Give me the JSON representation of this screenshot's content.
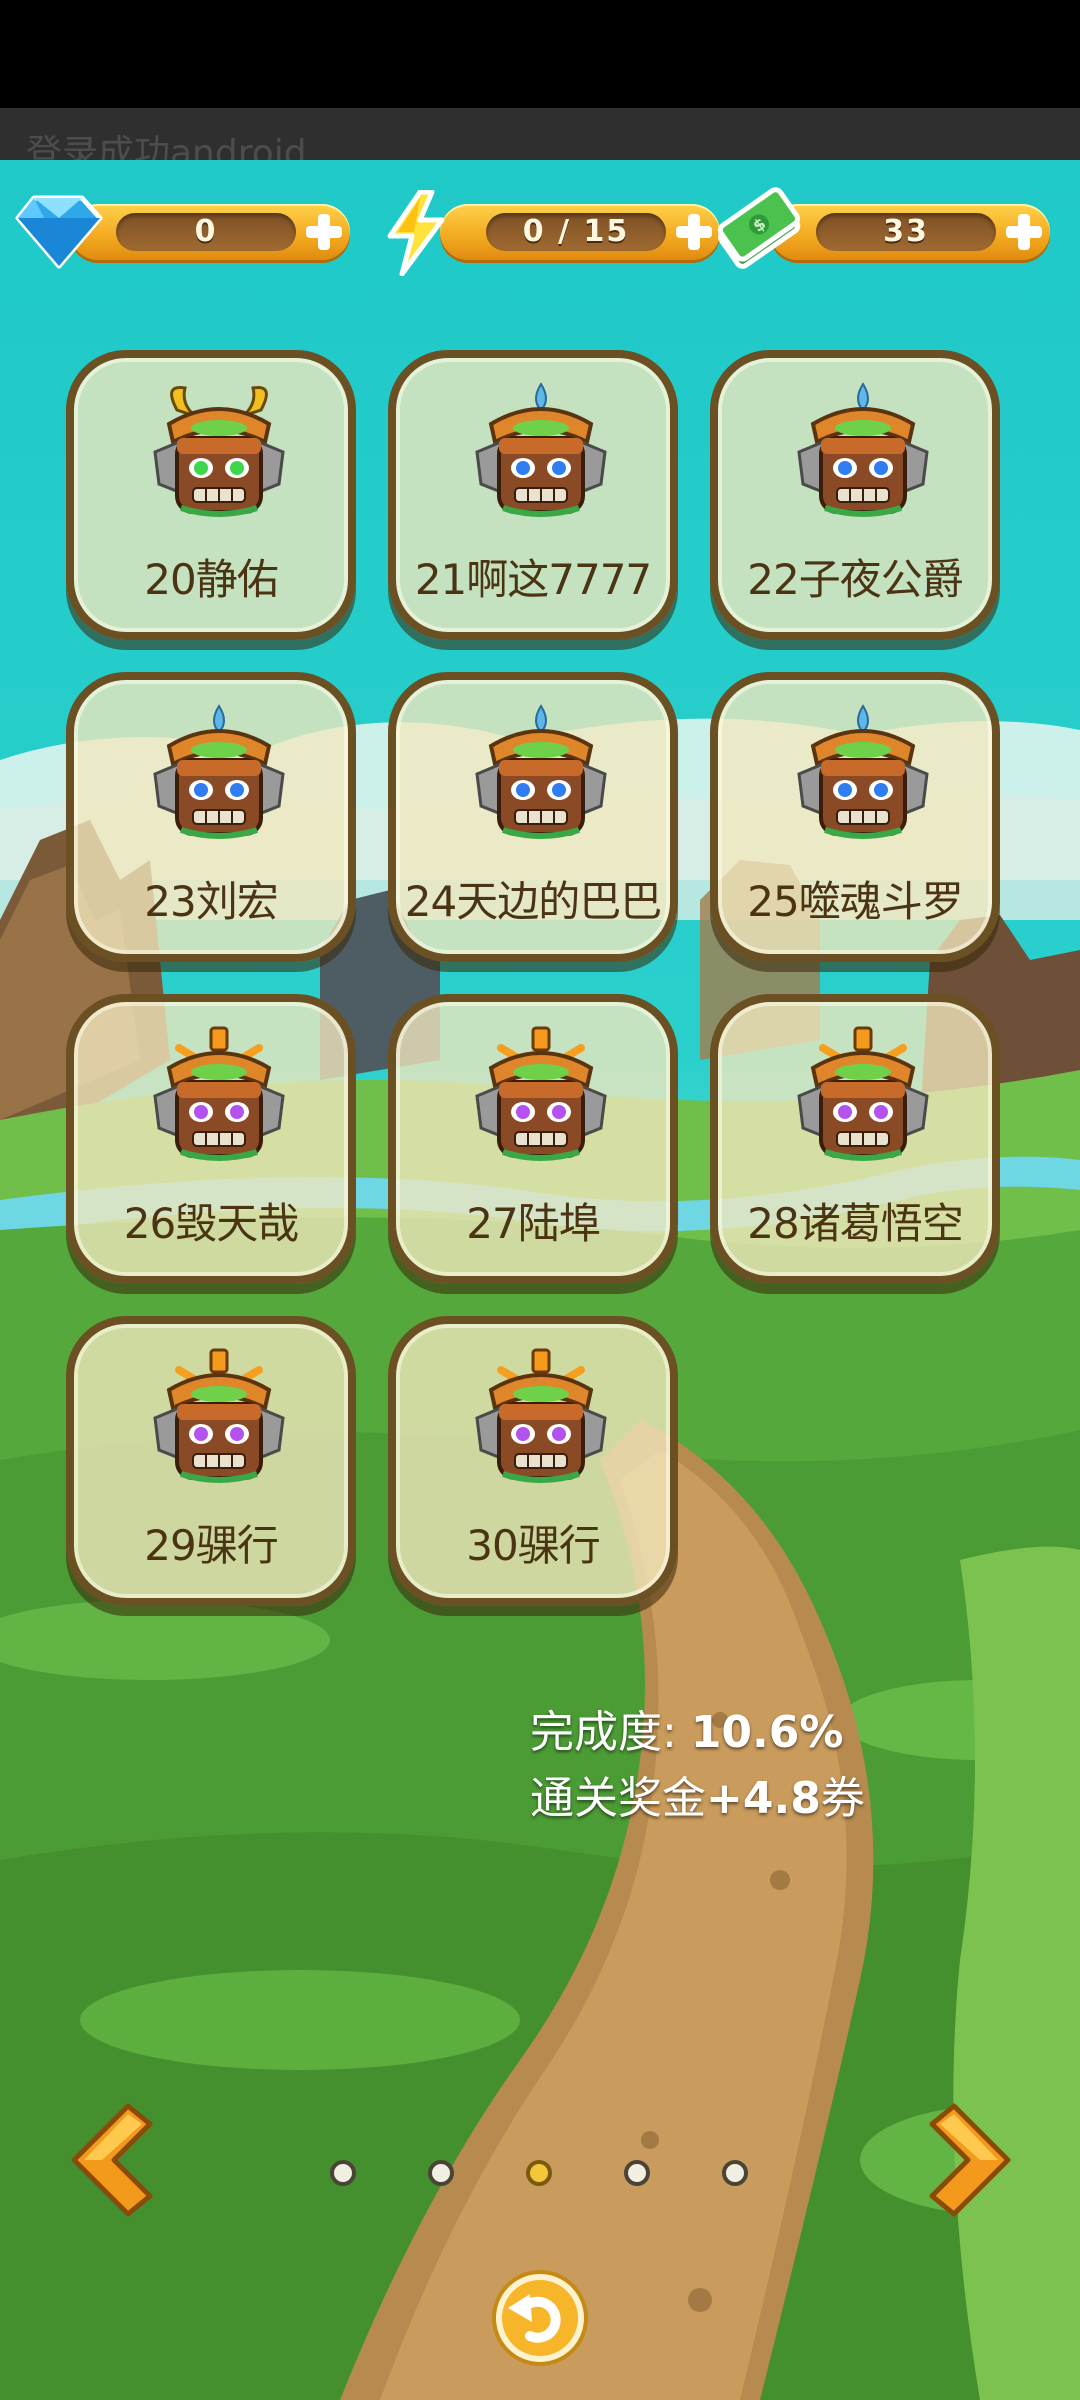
{
  "toast": "登录成功android",
  "resources": {
    "diamonds": "0",
    "energy": "0 / 15",
    "cash": "33"
  },
  "players": [
    {
      "label": "20静佑",
      "tier": "gold"
    },
    {
      "label": "21啊这7777",
      "tier": "blue"
    },
    {
      "label": "22子夜公爵",
      "tier": "blue"
    },
    {
      "label": "23刘宏",
      "tier": "blue"
    },
    {
      "label": "24天边的巴巴",
      "tier": "blue"
    },
    {
      "label": "25噬魂斗罗",
      "tier": "blue"
    },
    {
      "label": "26毁天哉",
      "tier": "purple"
    },
    {
      "label": "27陆埠",
      "tier": "purple"
    },
    {
      "label": "28诸葛悟空",
      "tier": "purple"
    },
    {
      "label": "29骒行",
      "tier": "purple"
    },
    {
      "label": "30骒行",
      "tier": "purple"
    }
  ],
  "progress": {
    "completion_label": "完成度: ",
    "completion_value": "10.6%",
    "reward_label": "通关奖金",
    "reward_value": "+4.8",
    "reward_unit": "券"
  },
  "pager": {
    "page_count": 5,
    "current_page": 3
  },
  "icons": {
    "diamond": "diamond-icon",
    "energy": "lightning-icon",
    "cash": "cash-stack-icon",
    "prev": "chevron-left-icon",
    "next": "chevron-right-icon",
    "back": "return-arrow-icon"
  }
}
